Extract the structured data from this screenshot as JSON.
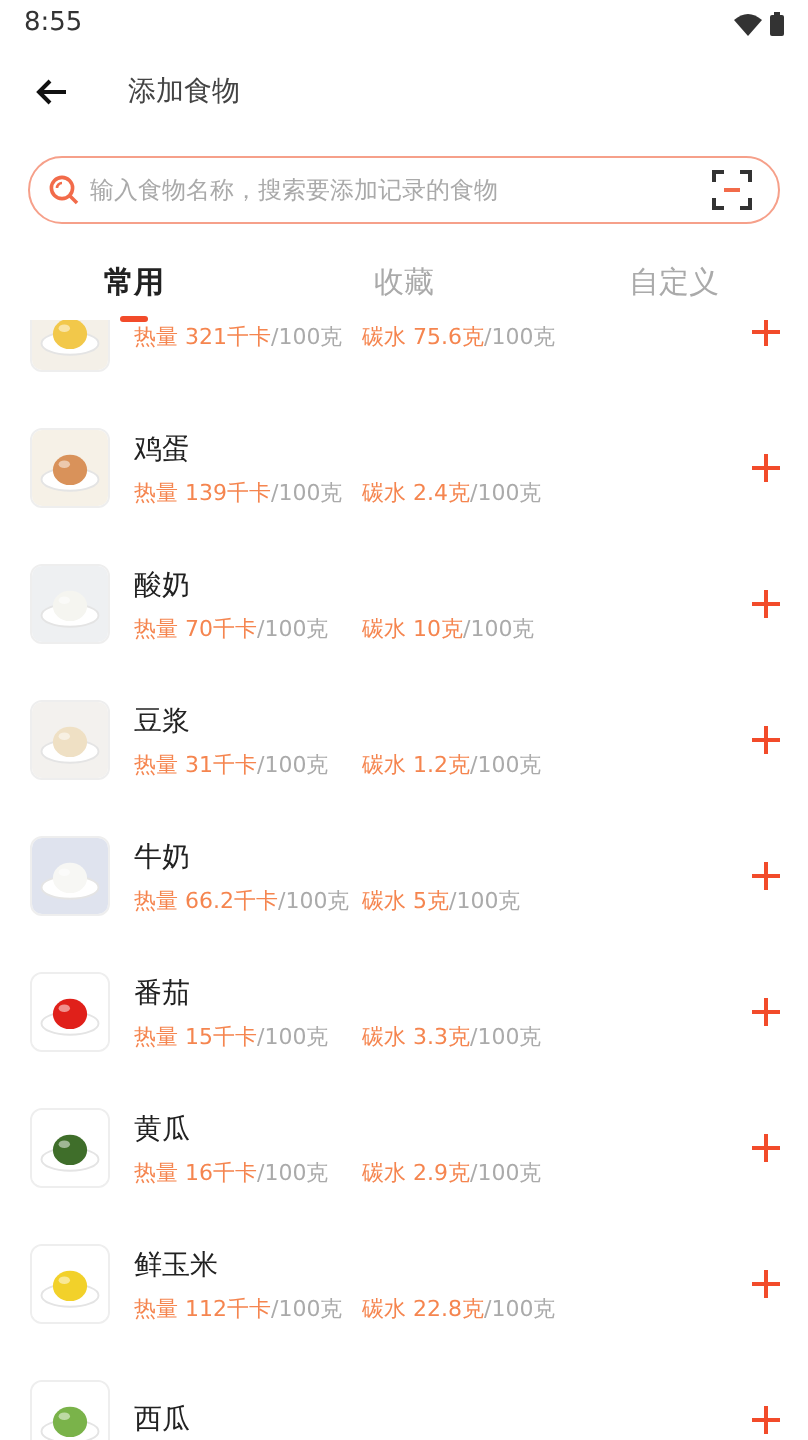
{
  "status_bar": {
    "time": "8:55"
  },
  "header": {
    "title": "添加食物"
  },
  "search": {
    "placeholder": "输入食物名称，搜索要添加记录的食物"
  },
  "tabs": [
    {
      "label": "常用",
      "selected": true
    },
    {
      "label": "收藏",
      "selected": false
    },
    {
      "label": "自定义",
      "selected": false
    }
  ],
  "foods": [
    {
      "calories": "热量 321千卡",
      "calories_unit": "/100克",
      "carbs": "碳水 75.6克",
      "carbs_unit": "/100克"
    },
    {
      "name": "鸡蛋",
      "calories": "热量 139千卡",
      "calories_unit": "/100克",
      "carbs": "碳水 2.4克",
      "carbs_unit": "/100克"
    },
    {
      "name": "酸奶",
      "calories": "热量 70千卡",
      "calories_unit": "/100克",
      "carbs": "碳水 10克",
      "carbs_unit": "/100克"
    },
    {
      "name": "豆浆",
      "calories": "热量 31千卡",
      "calories_unit": "/100克",
      "carbs": "碳水 1.2克",
      "carbs_unit": "/100克"
    },
    {
      "name": "牛奶",
      "calories": "热量 66.2千卡",
      "calories_unit": "/100克",
      "carbs": "碳水 5克",
      "carbs_unit": "/100克"
    },
    {
      "name": "番茄",
      "calories": "热量 15千卡",
      "calories_unit": "/100克",
      "carbs": "碳水 3.3克",
      "carbs_unit": "/100克"
    },
    {
      "name": "黄瓜",
      "calories": "热量 16千卡",
      "calories_unit": "/100克",
      "carbs": "碳水 2.9克",
      "carbs_unit": "/100克"
    },
    {
      "name": "鲜玉米",
      "calories": "热量 112千卡",
      "calories_unit": "/100克",
      "carbs": "碳水 22.8克",
      "carbs_unit": "/100克"
    },
    {
      "name": "西瓜"
    }
  ]
}
